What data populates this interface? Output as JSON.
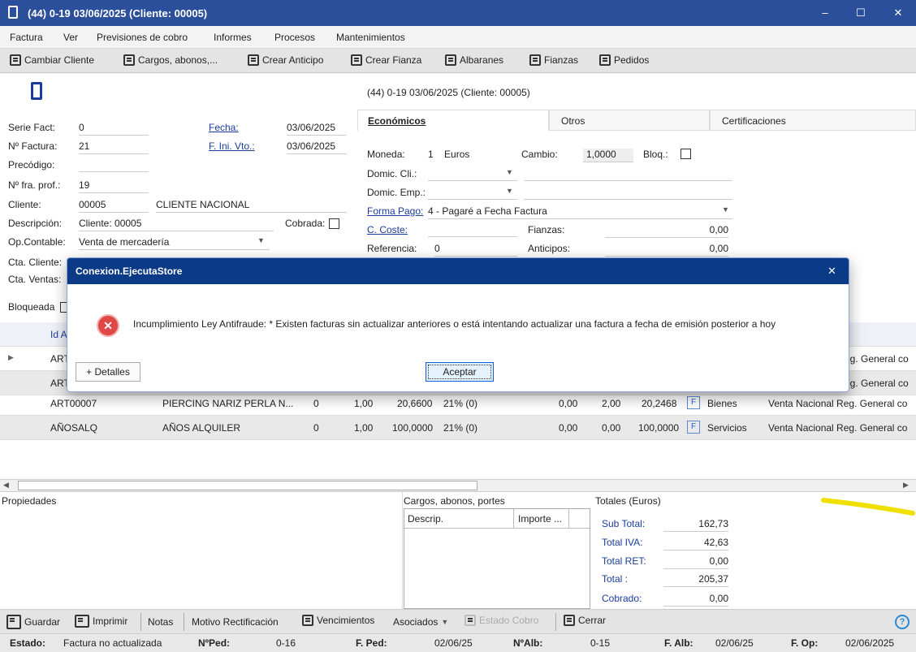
{
  "window": {
    "title": "(44) 0-19 03/06/2025 (Cliente: 00005)",
    "controls": {
      "minimize": "–",
      "maximize": "☐",
      "close": "✕"
    }
  },
  "menu": [
    "Factura",
    "Ver",
    "Previsiones de cobro",
    "Informes",
    "Procesos",
    "Mantenimientos"
  ],
  "toolbar": {
    "cambiar_cliente": "Cambiar Cliente",
    "cargos": "Cargos, abonos,...",
    "crear_anticipo": "Crear Anticipo",
    "crear_fianza": "Crear Fianza",
    "albaranes": "Albaranes",
    "fianzas": "Fianzas",
    "pedidos": "Pedidos"
  },
  "header_caption": "(44) 0-19 03/06/2025 (Cliente: 00005)",
  "form": {
    "serie_label": "Serie Fact:",
    "serie": "0",
    "fecha_label": "Fecha:",
    "fecha": "03/06/2025",
    "nfactura_label": "Nº Factura:",
    "nfactura": "21",
    "finivto_label": "F. Ini. Vto.:",
    "finivto": "03/06/2025",
    "precodigo_label": "Precódigo:",
    "nfraprof_label": "Nº fra. prof.:",
    "nfraprof": "19",
    "cliente_label": "Cliente:",
    "cliente_code": "00005",
    "cliente_name": "CLIENTE NACIONAL",
    "descripcion_label": "Descripción:",
    "descripcion": "Cliente: 00005",
    "cobrada_label": "Cobrada:",
    "opcontable_label": "Op.Contable:",
    "opcontable": "Venta de mercadería",
    "ctacliente_label": "Cta. Cliente:",
    "ctaventas_label": "Cta. Ventas:",
    "bloqueada_label": "Bloqueada"
  },
  "tabs": [
    "Económicos",
    "Otros",
    "Certificaciones"
  ],
  "economicos": {
    "moneda_label": "Moneda:",
    "moneda_code": "1",
    "moneda": "Euros",
    "cambio_label": "Cambio:",
    "cambio": "1,0000",
    "bloq_label": "Bloq.:",
    "domcli_label": "Domic. Cli.:",
    "domemp_label": "Domic. Emp.:",
    "formapago_label": "Forma Pago:",
    "formapago": "4 - Pagaré a Fecha Factura",
    "ccoste_label": "C. Coste:",
    "fianzas_label": "Fianzas:",
    "fianzas": "0,00",
    "referencia_label": "Referencia:",
    "referencia": "0",
    "anticipos_label": "Anticipos:",
    "anticipos": "0,00"
  },
  "grid": {
    "header_id": "Id A",
    "rows": [
      {
        "id": "ART",
        "tail": "eg. General co"
      },
      {
        "id": "ART",
        "tail": "eg. General co"
      },
      {
        "id": "ART00007",
        "desc": "PIERCING NARIZ PERLA N...",
        "c1": "0",
        "qty": "1,00",
        "price": "20,6600",
        "iva": "21% (0)",
        "d1": "0,00",
        "d2": "2,00",
        "total": "20,2468",
        "f": "F",
        "tipo": "Bienes",
        "op": "Venta Nacional Reg. General co"
      },
      {
        "id": "AÑOSALQ",
        "desc": "AÑOS ALQUILER",
        "c1": "0",
        "qty": "1,00",
        "price": "100,0000",
        "iva": "21% (0)",
        "d1": "0,00",
        "d2": "0,00",
        "total": "100,0000",
        "f": "F",
        "tipo": "Servicios",
        "op": "Venta Nacional Reg. General co"
      }
    ]
  },
  "bottom": {
    "propiedades": "Propiedades",
    "cargos_title": "Cargos, abonos, portes",
    "cargos_cols": [
      "Descrip.",
      "Importe ..."
    ],
    "totales_title": "Totales (Euros)",
    "subtotal_label": "Sub Total:",
    "subtotal": "162,73",
    "iva_label": "Total IVA:",
    "iva": "42,63",
    "ret_label": "Total RET:",
    "ret": "0,00",
    "total_label": "Total :",
    "total": "205,37",
    "cobrado_label": "Cobrado:",
    "cobrado": "0,00"
  },
  "bottom_toolbar": {
    "guardar": "Guardar",
    "imprimir": "Imprimir",
    "notas": "Notas",
    "motivo": "Motivo Rectificación",
    "vencimientos": "Vencimientos",
    "asociados": "Asociados",
    "estado_cobro": "Estado Cobro",
    "cerrar": "Cerrar"
  },
  "status": {
    "estado_label": "Estado:",
    "estado": "Factura no actualizada",
    "nped_label": "NºPed:",
    "nped": "0-16",
    "fped_label": "F. Ped:",
    "fped": "02/06/25",
    "nalb_label": "NºAlb:",
    "nalb": "0-15",
    "falb_label": "F. Alb:",
    "falb": "02/06/25",
    "fop_label": "F. Op:",
    "fop": "02/06/2025"
  },
  "dialog": {
    "title": "Conexion.EjecutaStore",
    "message": "Incumplimiento Ley Antifraude: * Existen facturas sin actualizar anteriores o está intentando actualizar una factura a fecha de emisión posterior a hoy",
    "details": "+ Detalles",
    "ok": "Aceptar"
  }
}
